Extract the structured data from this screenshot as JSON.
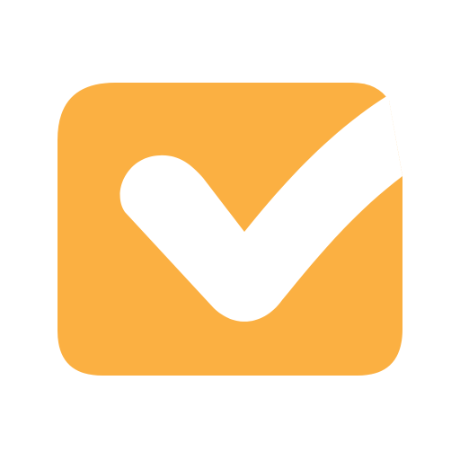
{
  "icon": {
    "name": "checkbox-check-icon",
    "box_color": "#FBB042",
    "check_color": "#FFFFFF",
    "background_color": "#FFFFFF"
  }
}
